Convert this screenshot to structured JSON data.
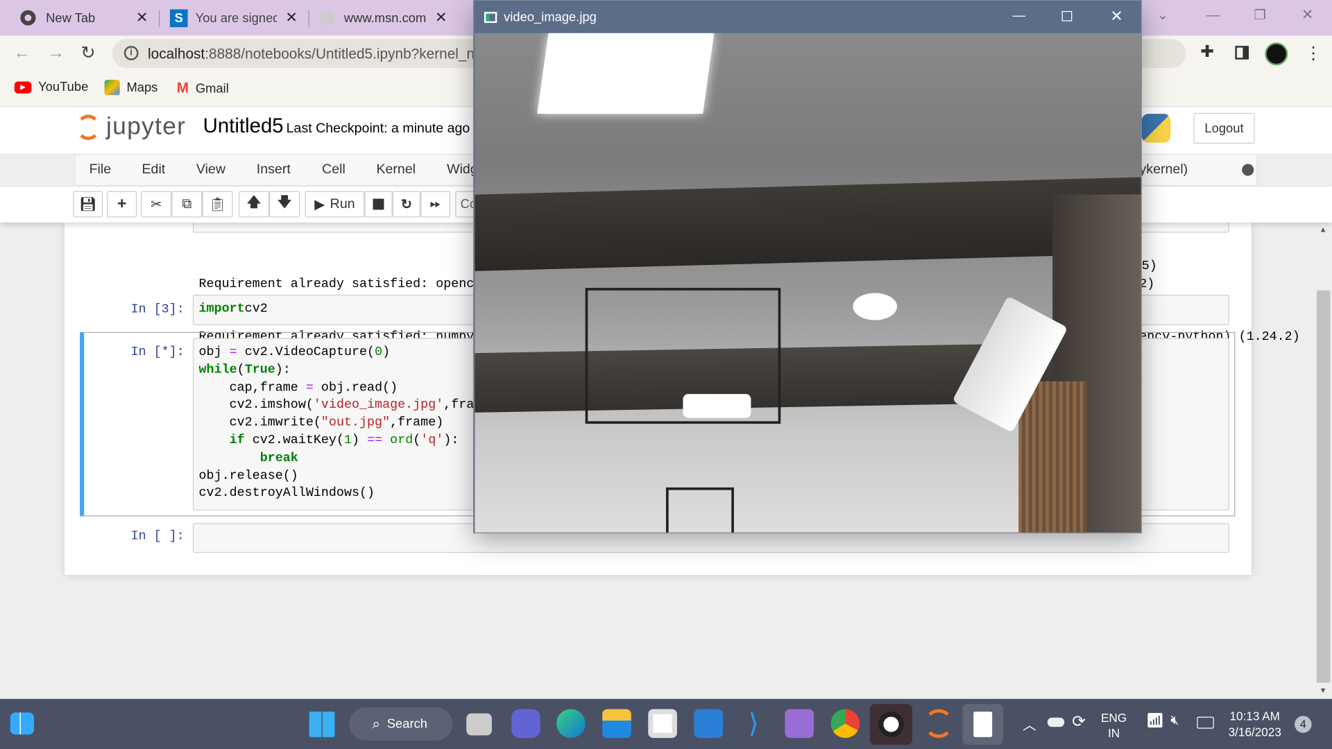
{
  "browser": {
    "tabs": [
      {
        "label": "New Tab",
        "icon": "chrome-icon"
      },
      {
        "label": "You are signed",
        "icon": "s-logo-icon"
      },
      {
        "label": "www.msn.com",
        "icon": "globe-icon"
      }
    ],
    "url_host": "localhost",
    "url_rest": ":8888/notebooks/Untitled5.ipynb?kernel_name=python3",
    "bookmarks": [
      {
        "label": "YouTube"
      },
      {
        "label": "Maps"
      },
      {
        "label": "Gmail"
      }
    ]
  },
  "jupyter": {
    "logo_text": "jupyter",
    "notebook_name": "Untitled5",
    "checkpoint": "Last Checkpoint: a minute ago",
    "logout": "Logout",
    "kernel": "Python 3 (ipykernel)",
    "menu": [
      "File",
      "Edit",
      "View",
      "Insert",
      "Cell",
      "Kernel",
      "Widgets"
    ],
    "run_label": "Run",
    "cell_type": "Code"
  },
  "cells": {
    "output": [
      "Requirement already satisfied: opencv-python in c:\\users\\appdata\\local\\programs\\python\\python310\\lib\\site-packages (4.7.0.72)",
      "Requirement already satisfied: numpy>=1.17.3 in c:\\users\\appdata\\local\\programs\\python\\python310\\lib\\site-packages (from opencv-python) (1.24.2)"
    ],
    "output_tail": "5)",
    "prompt3": "In [3]:",
    "prompt_star": "In [*]:",
    "prompt_empty": "In [ ]:",
    "cell3": [
      [
        [
          "kw",
          "import"
        ],
        [
          "",
          "cv2"
        ]
      ]
    ],
    "cell4": [
      [
        [
          "",
          "obj "
        ],
        [
          "op",
          "="
        ],
        [
          "",
          " cv2.VideoCapture("
        ],
        [
          "nm",
          "0"
        ],
        [
          "",
          ")"
        ]
      ],
      [
        [
          "kw",
          "while"
        ],
        [
          "",
          "("
        ],
        [
          "kw",
          "True"
        ],
        [
          "",
          "):"
        ]
      ],
      [
        [
          "",
          "    cap,frame "
        ],
        [
          "op",
          "="
        ],
        [
          "",
          " obj.read()"
        ]
      ],
      [
        [
          "",
          "    cv2.imshow("
        ],
        [
          "st",
          "'video_image.jpg'"
        ],
        [
          "",
          ",frame)"
        ]
      ],
      [
        [
          "",
          "    cv2.imwrite("
        ],
        [
          "st",
          "\"out.jpg\""
        ],
        [
          "",
          ",frame)"
        ]
      ],
      [
        [
          "kw",
          "    if"
        ],
        [
          "",
          " cv2.waitKey("
        ],
        [
          "nm",
          "1"
        ],
        [
          "",
          ") "
        ],
        [
          "op",
          "=="
        ],
        [
          "",
          " "
        ],
        [
          "bi",
          "ord"
        ],
        [
          "",
          "("
        ],
        [
          "st",
          "'q'"
        ],
        [
          "",
          "):"
        ]
      ],
      [
        [
          "kw",
          "        break"
        ]
      ],
      [
        [
          "",
          "obj.release()"
        ]
      ],
      [
        [
          "",
          "cv2.destroyAllWindows()"
        ]
      ]
    ]
  },
  "video_window": {
    "title": "video_image.jpg"
  },
  "taskbar": {
    "search": "Search",
    "lang1": "ENG",
    "lang2": "IN",
    "time": "10:13 AM",
    "date": "3/16/2023",
    "notifications": "4"
  },
  "colors": {
    "tabbar": "#dcc6e6",
    "taskbar": "#4a5164",
    "jupyter_orange": "#f37626",
    "cell_active": "#42a5f5",
    "video_titlebar": "#5c6d88"
  }
}
